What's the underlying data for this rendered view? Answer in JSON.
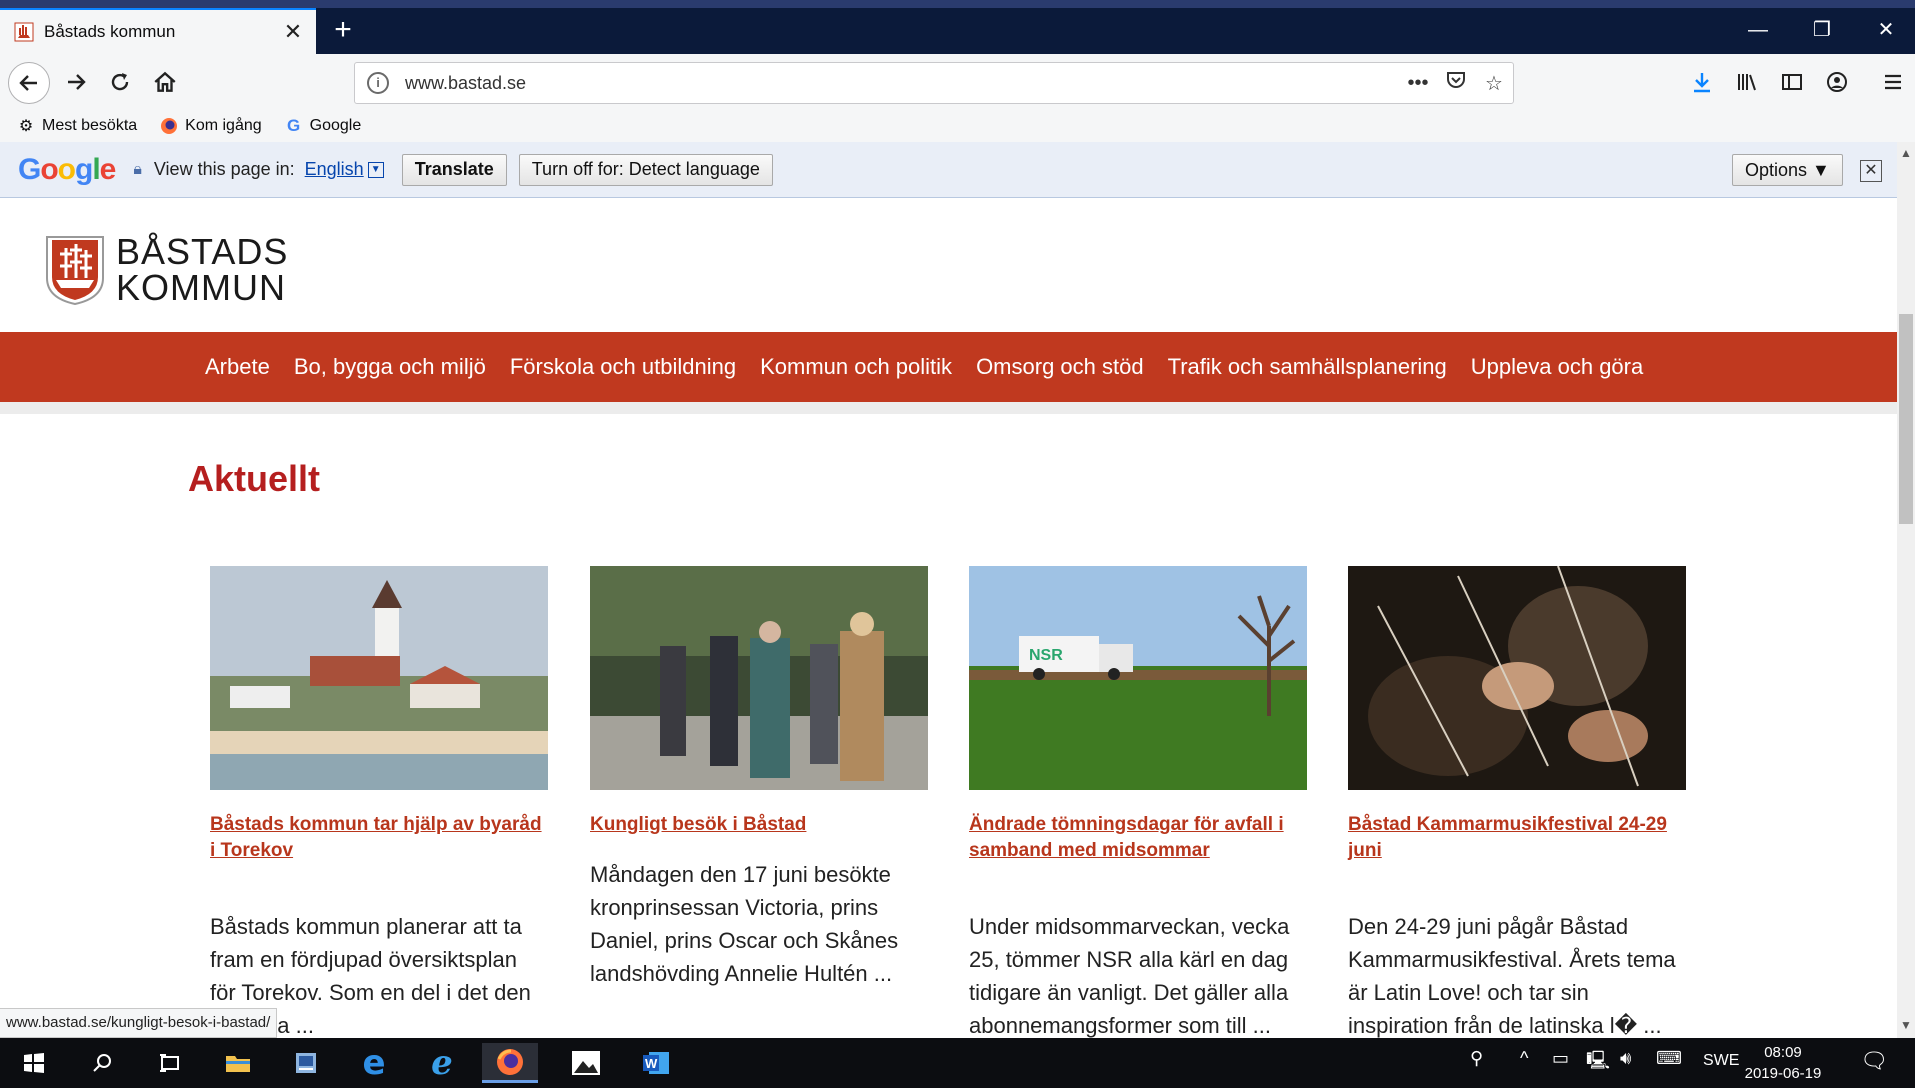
{
  "browser": {
    "tab_title": "Båstads kommun",
    "url": "www.bastad.se",
    "bookmarks": [
      "Mest besökta",
      "Kom igång",
      "Google"
    ]
  },
  "translate_bar": {
    "logo": "Google",
    "view_in": "View this page in:",
    "language": "English",
    "translate_button": "Translate",
    "turn_off_button": "Turn off for: Detect language",
    "options_button": "Options ▼"
  },
  "site": {
    "logo_line1": "BÅSTADS",
    "logo_line2": "KOMMUN",
    "nav": [
      "Arbete",
      "Bo, bygga och miljö",
      "Förskola och utbildning",
      "Kommun och politik",
      "Omsorg och stöd",
      "Trafik och samhällsplanering",
      "Uppleva och göra"
    ],
    "heading": "Aktuellt",
    "cards": [
      {
        "title": "Båstads kommun tar hjälp av byaråd i Torekov",
        "desc": "Båstads kommun planerar att ta fram en fördjupad översiktsplan för Torekov. Som en del i det den politiska ..."
      },
      {
        "title": "Kungligt besök i Båstad",
        "desc": "Måndagen den 17 juni besökte kronprinsessan Victoria, prins Daniel, prins Oscar och Skånes landshövding Annelie Hultén ..."
      },
      {
        "title": "Ändrade tömningsdagar för avfall i samband med midsommar",
        "desc": "Under midsommarveckan, vecka 25, tömmer NSR alla kärl en dag tidigare än vanligt. Det gäller alla abonnemangsformer som till ..."
      },
      {
        "title": "Båstad Kammarmusikfestival 24-29 juni",
        "desc": "Den 24-29 juni pågår Båstad Kammarmusikfestival. Årets tema är Latin Love! och tar sin inspiration från de latinska l� ..."
      }
    ]
  },
  "status_url": "www.bastad.se/kungligt-besok-i-bastad/",
  "taskbar": {
    "language": "SWE",
    "time": "08:09",
    "date": "2019-06-19"
  },
  "colors": {
    "nav_red": "#c0391f",
    "heading_red": "#b51f1f",
    "link_red": "#b8361c"
  }
}
